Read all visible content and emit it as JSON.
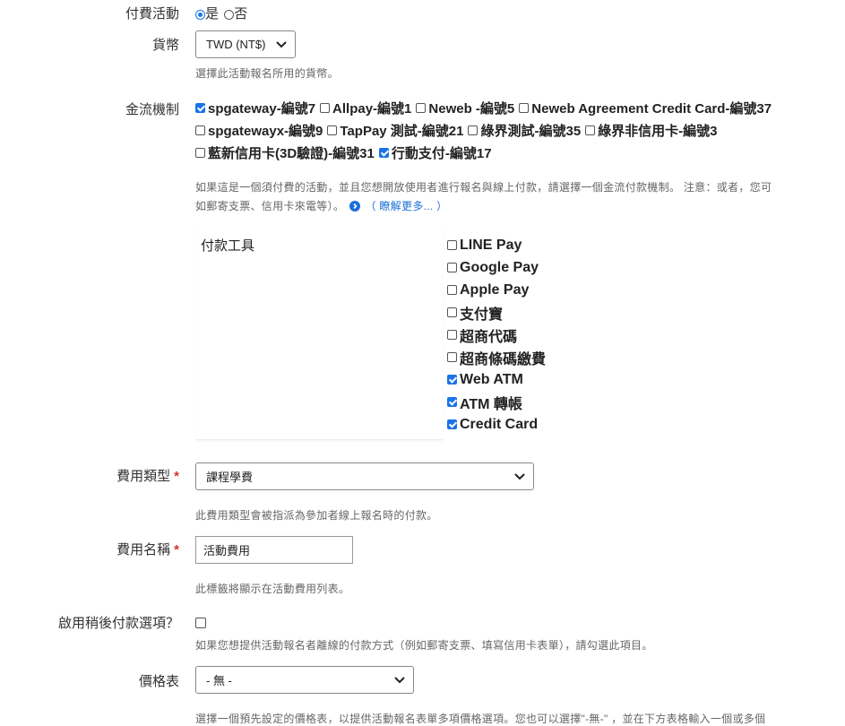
{
  "paid_activity": {
    "label": "付費活動",
    "yes": "是",
    "no": "否",
    "selected": "yes"
  },
  "currency": {
    "label": "貨幣",
    "value": "TWD (NT$)",
    "help": "選擇此活動報名所用的貨幣。"
  },
  "gateway": {
    "label": "金流機制",
    "rows": [
      [
        {
          "label": "spgateway-編號7",
          "checked": true
        },
        {
          "label": "Allpay-編號1",
          "checked": false
        },
        {
          "label": "Neweb -編號5",
          "checked": false
        },
        {
          "label": "Neweb Agreement Credit Card-編號37",
          "checked": false
        }
      ],
      [
        {
          "label": "spgatewayx-編號9",
          "checked": false
        },
        {
          "label": "TapPay 測試-編號21",
          "checked": false
        },
        {
          "label": "綠界測試-編號35",
          "checked": false
        },
        {
          "label": "綠界非信用卡-編號3",
          "checked": false
        }
      ],
      [
        {
          "label": "藍新信用卡(3D驗證)-編號31",
          "checked": false
        },
        {
          "label": "行動支付-編號17",
          "checked": true
        }
      ]
    ],
    "help_line1": "如果這是一個須付費的活動，並且您想開放使用者進行報名與線上付款，請選擇一個金流付款機制。 注意：或者，您可",
    "help_line2": "如郵寄支票、信用卡來電等）。",
    "learn_more": "（ 瞭解更多... ）"
  },
  "payment_tools": {
    "title": "付款工具",
    "items": [
      {
        "label": "LINE Pay",
        "checked": false
      },
      {
        "label": "Google Pay",
        "checked": false
      },
      {
        "label": "Apple Pay",
        "checked": false
      },
      {
        "label": "支付寶",
        "checked": false
      },
      {
        "label": "超商代碼",
        "checked": false
      },
      {
        "label": "超商條碼繳費",
        "checked": false
      },
      {
        "label": "Web ATM",
        "checked": true
      },
      {
        "label": "ATM 轉帳",
        "checked": true
      },
      {
        "label": "Credit Card",
        "checked": true
      }
    ]
  },
  "fee_type": {
    "label": "費用類型",
    "required_mark": "*",
    "value": "課程學費",
    "help": "此費用類型會被指派為參加者線上報名時的付款。"
  },
  "fee_name": {
    "label": "費用名稱",
    "required_mark": "*",
    "value": "活動費用",
    "help": "此標籤將顯示在活動費用列表。"
  },
  "pay_later": {
    "label": "啟用稍後付款選項？",
    "checked": false,
    "help": "如果您想提供活動報名者離線的付款方式（例如郵寄支票、填寫信用卡表單），請勾選此項目。"
  },
  "price_set": {
    "label": "價格表",
    "value": "- 無 -",
    "help": "選擇一個預先設定的價格表，以提供活動報名表單多項價格選項。您也可以選擇\"-無-\" ，並在下方表格輸入一個或多個"
  },
  "colors": {
    "accent": "#1a73e8",
    "required": "#d9302b",
    "link": "#1a6fd8"
  }
}
